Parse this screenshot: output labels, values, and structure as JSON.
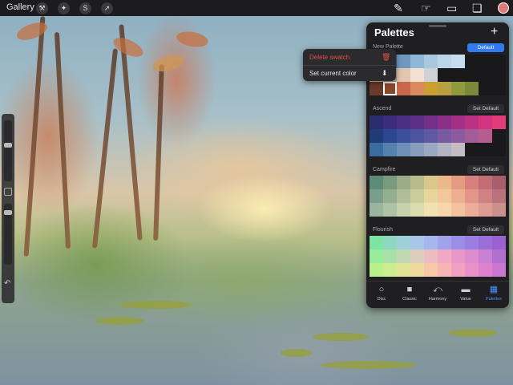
{
  "topbar": {
    "gallery_label": "Gallery",
    "tool_icons": [
      "wrench-icon",
      "magic-wand-icon",
      "selection-icon",
      "transform-arrow-icon"
    ],
    "right_icons": [
      "brush-icon",
      "smudge-icon",
      "eraser-icon",
      "layers-icon"
    ],
    "current_color": "#e07a7a"
  },
  "popup": {
    "delete_label": "Delete swatch",
    "set_color_label": "Set current color",
    "delete_color": "#e0504a"
  },
  "panel": {
    "title": "Palettes",
    "palettes": [
      {
        "name": "New Palette",
        "default_label": "Default",
        "is_default": true,
        "rows": [
          [
            "#2a3a5a",
            "#4a6a8a",
            "#6f9ac0",
            "#8fb8d8",
            "#a8c8e0",
            "#bad4e8",
            "#c8dcef",
            null,
            null,
            null
          ],
          [
            "#d4cdbf",
            "#a9a49a",
            "#e2c6b0",
            "#f2e0d0",
            "#cfd3d8",
            null,
            null,
            null,
            null,
            null
          ],
          [
            "#6a3a2a",
            "#8a4a2a",
            "#c8674a",
            "#d98a60",
            "#c9a030",
            "#b8a040",
            "#8f9a3c",
            "#7b8a3a",
            null,
            null
          ]
        ]
      },
      {
        "name": "Ascend",
        "default_label": "Set Default",
        "is_default": false,
        "rows": [
          [
            "#2b2c6e",
            "#3a2e7c",
            "#4b2f83",
            "#5e2f87",
            "#742f88",
            "#8b2f87",
            "#a33085",
            "#bb3282",
            "#d2357e",
            "#e13b7a"
          ],
          [
            "#203a7a",
            "#2d4690",
            "#3c4f99",
            "#4e55a0",
            "#6158a2",
            "#775aa2",
            "#8c5b9f",
            "#a35c98",
            "#b65d8f",
            null
          ],
          [
            "#3b6ca0",
            "#5581ad",
            "#6e90b6",
            "#869dbc",
            "#9ca8c0",
            "#b1b3c2",
            "#c4bcc4",
            null,
            null,
            null
          ]
        ]
      },
      {
        "name": "Campfire",
        "default_label": "Set Default",
        "is_default": false,
        "rows": [
          [
            "#5e8a78",
            "#7a9a80",
            "#9aab87",
            "#b8bc8d",
            "#d8c88e",
            "#eab88c",
            "#e59a82",
            "#d67f7c",
            "#c26d74",
            "#a85e6c"
          ],
          [
            "#7a9e8a",
            "#94ae90",
            "#afbe96",
            "#cccc9a",
            "#e6d69c",
            "#f2c89a",
            "#eeaf90",
            "#e2968a",
            "#d08283",
            "#b8737c"
          ],
          [
            "#9ab49e",
            "#b0c2a4",
            "#c6d0aa",
            "#dcdcae",
            "#f0e2b0",
            "#f6d6aa",
            "#f3c2a0",
            "#ecae98",
            "#de9c93",
            "#cb8f8c"
          ]
        ]
      },
      {
        "name": "Flourish",
        "default_label": "Set Default",
        "is_default": false,
        "rows": [
          [
            "#7ee4a4",
            "#8ed8c0",
            "#9fd0d8",
            "#a8c6e8",
            "#a6b6ee",
            "#a0a2ec",
            "#9a8ee6",
            "#9a7ee0",
            "#9a70d8",
            "#9a62d0"
          ],
          [
            "#96ec9a",
            "#a8e0a8",
            "#c0d8b4",
            "#dacdbc",
            "#ecbcc0",
            "#f0a8c4",
            "#e898c8",
            "#da8ccc",
            "#c880d0",
            "#b070d0"
          ],
          [
            "#b8f08a",
            "#ccec90",
            "#dfe496",
            "#efd89e",
            "#f6c8a8",
            "#f6b4b4",
            "#f2a0c0",
            "#ea90c8",
            "#de82cc",
            "#cc76d0"
          ]
        ]
      }
    ],
    "tabs": [
      {
        "label": "Disc",
        "icon": "disc-icon"
      },
      {
        "label": "Classic",
        "icon": "classic-square-icon"
      },
      {
        "label": "Harmony",
        "icon": "harmony-icon"
      },
      {
        "label": "Value",
        "icon": "value-sliders-icon"
      },
      {
        "label": "Palettes",
        "icon": "palettes-grid-icon",
        "active": true
      }
    ]
  }
}
